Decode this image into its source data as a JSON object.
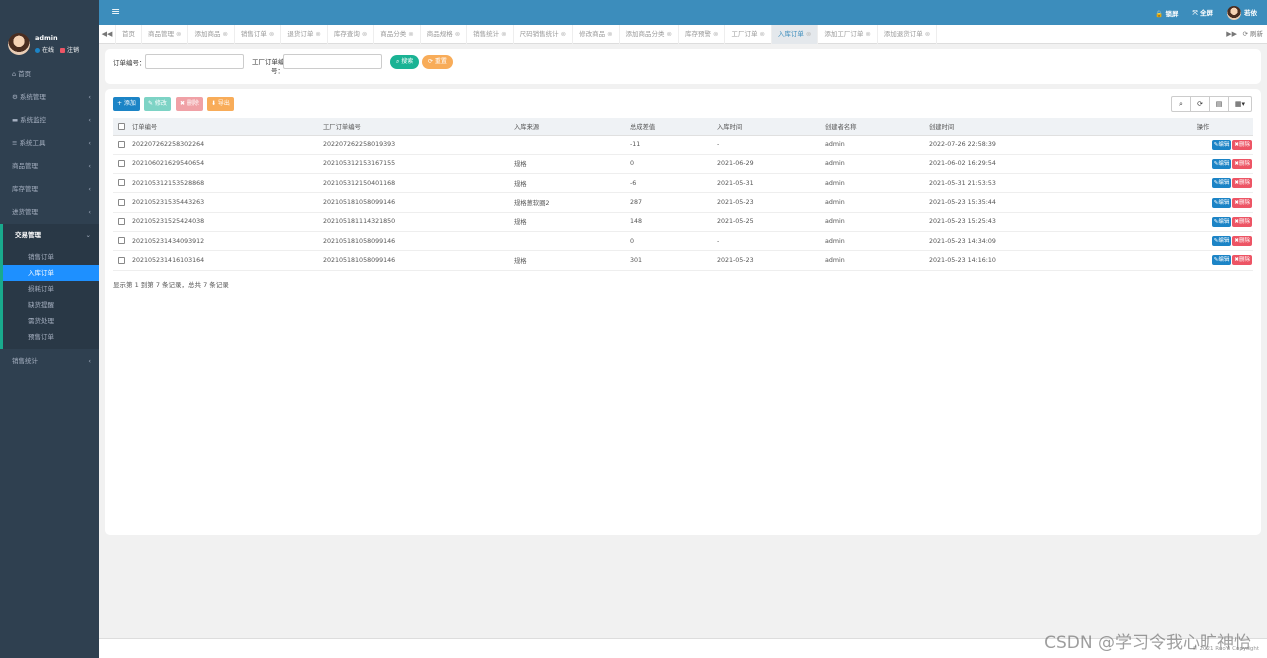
{
  "user": {
    "name": "admin",
    "online": "在线",
    "logout": "注销"
  },
  "menu": {
    "items": [
      {
        "icon": "home-icon",
        "glyph": "⌂",
        "label": "首页",
        "chev": ""
      },
      {
        "icon": "gear-icon",
        "glyph": "⚙",
        "label": "系统管理",
        "chev": "‹"
      },
      {
        "icon": "monitor-icon",
        "glyph": "▬",
        "label": "系统监控",
        "chev": "‹"
      },
      {
        "icon": "tools-icon",
        "glyph": "≡",
        "label": "系统工具",
        "chev": "‹"
      },
      {
        "icon": "",
        "glyph": "",
        "label": "商品管理",
        "chev": "‹"
      },
      {
        "icon": "",
        "glyph": "",
        "label": "库存管理",
        "chev": "‹"
      },
      {
        "icon": "",
        "glyph": "",
        "label": "进货管理",
        "chev": "‹"
      }
    ],
    "active_group": {
      "label": "交易管理",
      "chev": "⌄"
    },
    "sub_items": [
      "销售订单",
      "入库订单",
      "损耗订单",
      "缺货提醒",
      "需货处理",
      "预售订单"
    ],
    "last_item": {
      "label": "销售统计",
      "chev": "‹"
    }
  },
  "topbar": {
    "menu_glyph": "≡",
    "lock": "🔒 锁屏",
    "fullscreen": "⤧ 全屏",
    "username": "若依"
  },
  "tabs": {
    "items": [
      "首页",
      "商品管理",
      "添加商品",
      "销售订单",
      "退货订单",
      "库存查询",
      "商品分类",
      "商品规格",
      "销售统计",
      "尺码销售统计",
      "修改商品",
      "添加商品分类",
      "库存预警",
      "工厂订单",
      "入库订单",
      "添加工厂订单",
      "添加退货订单"
    ],
    "active": "入库订单",
    "close_glyph": "⊗",
    "refresh": "⟳ 刷新"
  },
  "search": {
    "order_no_label": "订单编号：",
    "factory_no_label_1": "工厂订单编",
    "factory_no_label_2": "号：",
    "order_no_value": "",
    "factory_no_value": "",
    "search_btn": "⌕ 搜索",
    "reset_btn": "⟳ 重置"
  },
  "toolbar": {
    "add": "+ 添加",
    "edit": "✎ 修改",
    "delete": "✖ 删除",
    "export": "⬇ 导出"
  },
  "colors": {
    "topbar": "#3c8dbc",
    "sidebar": "#2f4050",
    "add": "#1c84c6",
    "edit": "#7dd3c5",
    "delete": "#f0a1a6",
    "export": "#f8ac59",
    "search": "#1ab394",
    "reset": "#f8ac59",
    "row_edit": "#1c84c6",
    "row_delete": "#ed5565"
  },
  "table": {
    "headers": [
      "订单编号",
      "工厂订单编号",
      "入库来源",
      "总成差值",
      "入库时间",
      "创建者名称",
      "创建时间",
      "操作"
    ],
    "rows": [
      [
        "202207262258302264",
        "202207262258019393",
        "",
        "-11",
        "-",
        "admin",
        "2022-07-26 22:58:39"
      ],
      [
        "202106021629540654",
        "202105312153167155",
        "规格",
        "0",
        "2021-06-29",
        "admin",
        "2021-06-02 16:29:54"
      ],
      [
        "202105312153528868",
        "202105312150401168",
        "规格",
        "-6",
        "2021-05-31",
        "admin",
        "2021-05-31 21:53:53"
      ],
      [
        "202105231535443263",
        "202105181058099146",
        "规格葱软圈2",
        "287",
        "2021-05-23",
        "admin",
        "2021-05-23 15:35:44"
      ],
      [
        "202105231525424038",
        "202105181114321850",
        "规格",
        "148",
        "2021-05-25",
        "admin",
        "2021-05-23 15:25:43"
      ],
      [
        "202105231434093912",
        "202105181058099146",
        "",
        "0",
        "-",
        "admin",
        "2021-05-23 14:34:09"
      ],
      [
        "202105231416103164",
        "202105181058099146",
        "规格",
        "301",
        "2021-05-23",
        "admin",
        "2021-05-23 14:16:10"
      ]
    ],
    "row_edit": "✎编辑",
    "row_delete": "✖删除"
  },
  "pagination": "显示第 1 到第 7 条记录，总共 7 条记录",
  "footer": "© 2021 RuoYi Copyright",
  "watermark": "CSDN @学习令我心旷神怡"
}
